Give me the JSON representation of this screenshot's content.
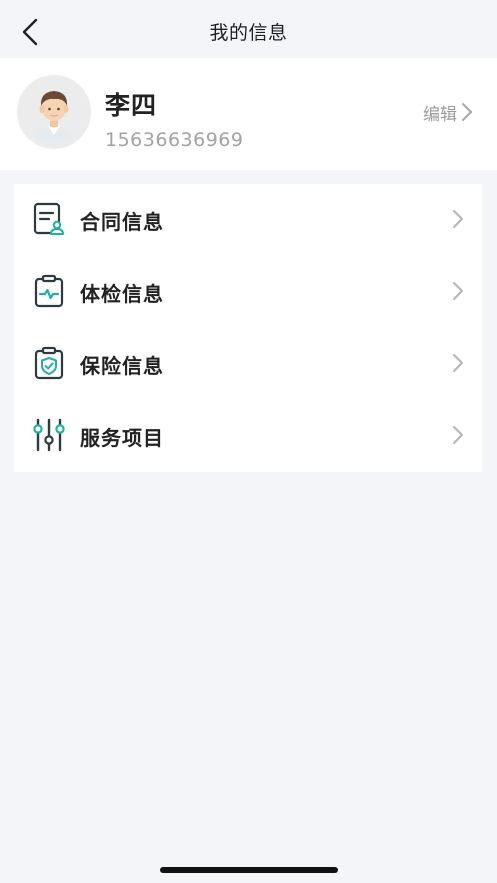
{
  "navbar": {
    "title": "我的信息",
    "back_icon": "chevron-left-icon"
  },
  "profile": {
    "name": "李四",
    "phone": "15636636969",
    "edit_label": "编辑",
    "avatar_icon": "user-avatar"
  },
  "menu": {
    "items": [
      {
        "label": "合同信息",
        "icon": "contract-icon"
      },
      {
        "label": "体检信息",
        "icon": "health-check-icon"
      },
      {
        "label": "保险信息",
        "icon": "insurance-shield-icon"
      },
      {
        "label": "服务项目",
        "icon": "sliders-icon"
      }
    ]
  },
  "colors": {
    "background": "#f4f5f9",
    "card": "#ffffff",
    "accent": "#23b0a3",
    "icon_dark": "#2f3a40",
    "muted_text": "#a2a2a2"
  }
}
